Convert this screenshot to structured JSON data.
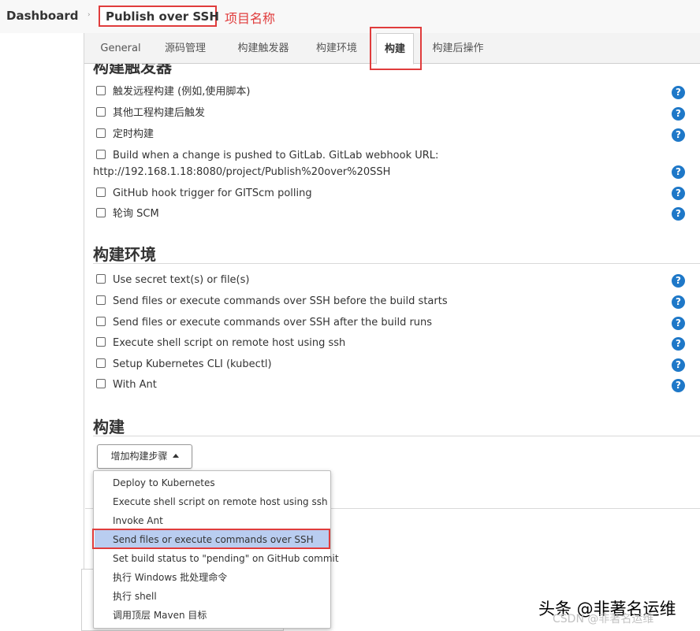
{
  "breadcrumb": {
    "dashboard": "Dashboard",
    "separator": "›",
    "project": "Publish over SSH",
    "project_annotation": "项目名称"
  },
  "tabs": [
    {
      "label": "General"
    },
    {
      "label": "源码管理"
    },
    {
      "label": "构建触发器"
    },
    {
      "label": "构建环境"
    },
    {
      "label": "构建",
      "active": true
    },
    {
      "label": "构建后操作"
    }
  ],
  "triggers": {
    "title": "构建触发器",
    "options": [
      {
        "label": "触发远程构建 (例如,使用脚本)",
        "checked": false
      },
      {
        "label": "其他工程构建后触发",
        "checked": false
      },
      {
        "label": "定时构建",
        "checked": false
      },
      {
        "label": "Build when a change is pushed to GitLab. GitLab webhook URL:",
        "checked": false
      },
      {
        "label": "GitHub hook trigger for GITScm polling",
        "checked": false
      },
      {
        "label": "轮询 SCM",
        "checked": false
      }
    ],
    "gitlab_url": "http://192.168.1.18:8080/project/Publish%20over%20SSH"
  },
  "environment": {
    "title": "构建环境",
    "options": [
      {
        "label": "Use secret text(s) or file(s)",
        "checked": false
      },
      {
        "label": "Send files or execute commands over SSH before the build starts",
        "checked": false
      },
      {
        "label": "Send files or execute commands over SSH after the build runs",
        "checked": false
      },
      {
        "label": "Execute shell script on remote host using ssh",
        "checked": false
      },
      {
        "label": "Setup Kubernetes CLI (kubectl)",
        "checked": false
      },
      {
        "label": "With Ant",
        "checked": false
      }
    ]
  },
  "build": {
    "title": "构建",
    "add_step_label": "增加构建步骤"
  },
  "help_icon_glyph": "?",
  "add_step_menu": {
    "items": [
      {
        "label": "Deploy to Kubernetes"
      },
      {
        "label": "Execute shell script on remote host using ssh"
      },
      {
        "label": "Invoke Ant"
      },
      {
        "label": "Send files or execute commands over SSH",
        "highlighted": true
      },
      {
        "label": "Set build status to \"pending\" on GitHub commit"
      },
      {
        "label": "执行 Windows 批处理命令"
      },
      {
        "label": "执行 shell"
      },
      {
        "label": "调用顶层 Maven 目标"
      }
    ]
  },
  "watermark": {
    "line1": "头条 @非著名运维",
    "line2": "CSDN @非著名运维"
  },
  "colors": {
    "annotation_red": "#e03c3c",
    "help_blue": "#1e78c8",
    "menu_highlight": "#b9cdf0"
  }
}
